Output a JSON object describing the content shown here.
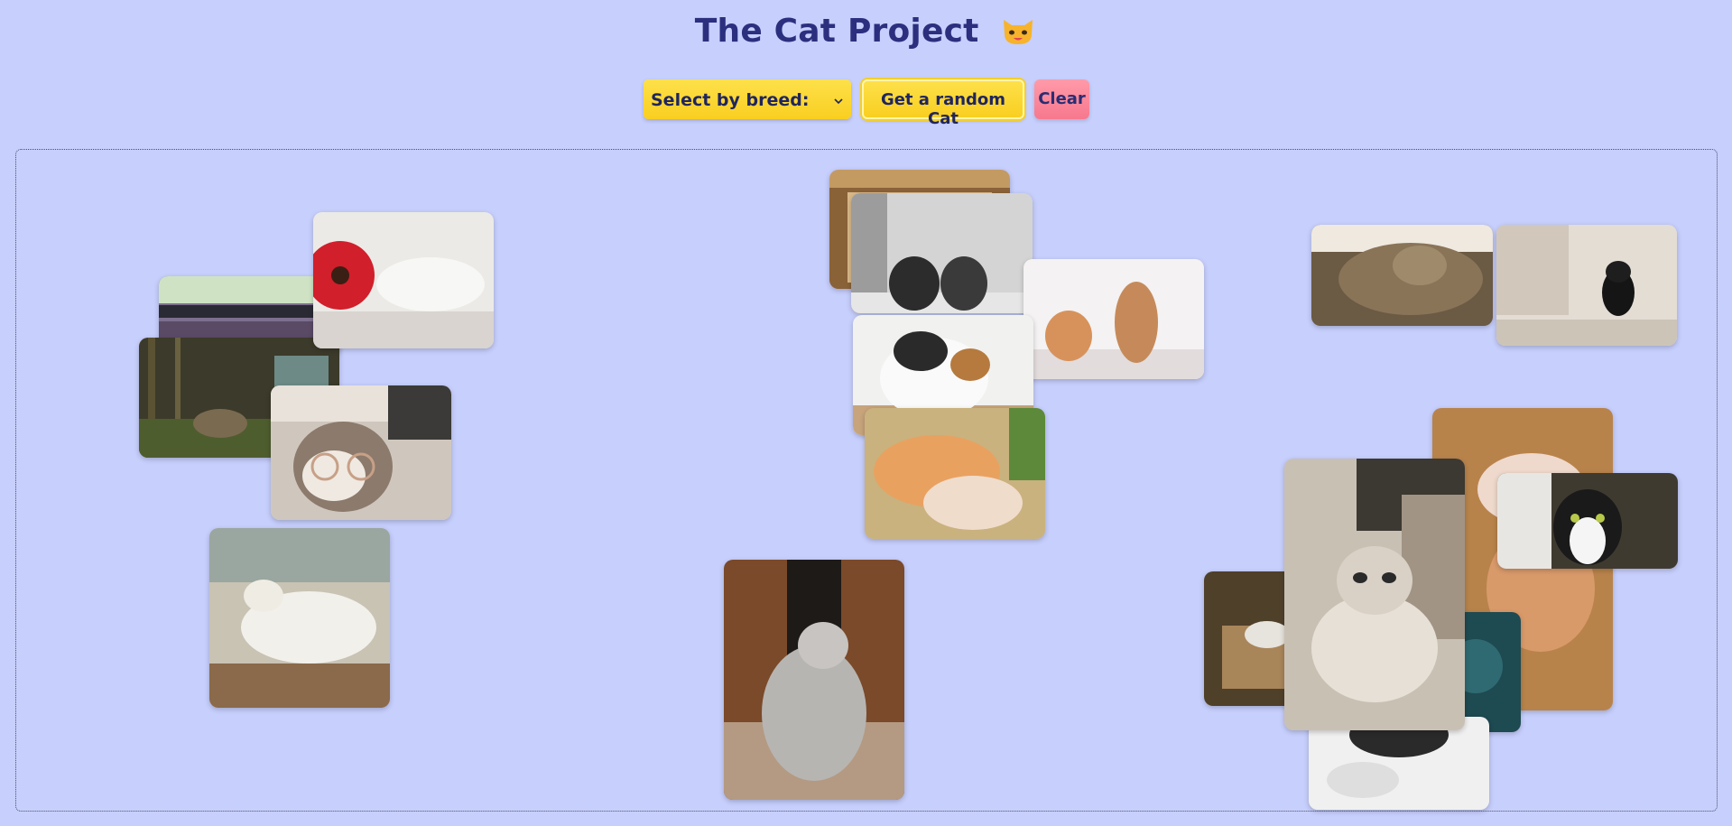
{
  "app": {
    "title": "The Cat Project",
    "title_icon": "cat-face-icon"
  },
  "controls": {
    "breed_select_label": "Select by breed:",
    "random_button_label": "Get a random Cat",
    "clear_button_label": "Clear"
  },
  "colors": {
    "background": "#c7cffd",
    "title": "#2b2f7e",
    "yellow_button": "#fad52c",
    "clear_button": "#f7788e"
  },
  "cat_photos": [
    {
      "name": "cat-photo-car-window"
    },
    {
      "name": "cat-photo-red-flower"
    },
    {
      "name": "cat-photo-forest"
    },
    {
      "name": "cat-photo-glasses"
    },
    {
      "name": "cat-photo-sleeping-white"
    },
    {
      "name": "cat-photo-box-top"
    },
    {
      "name": "cat-photo-two-black-cats"
    },
    {
      "name": "cat-photo-two-ginger-cats"
    },
    {
      "name": "cat-photo-calico"
    },
    {
      "name": "cat-photo-playing-kittens"
    },
    {
      "name": "cat-photo-grey-doorway"
    },
    {
      "name": "cat-photo-tabby-closeup"
    },
    {
      "name": "cat-photo-black-white-kitten"
    },
    {
      "name": "cat-photo-orange-carpet"
    },
    {
      "name": "cat-photo-tuxedo-portrait"
    },
    {
      "name": "cat-photo-cardboard-box"
    },
    {
      "name": "cat-photo-sepia-oriental"
    },
    {
      "name": "cat-photo-dark-teal"
    },
    {
      "name": "cat-photo-white-fur"
    }
  ]
}
